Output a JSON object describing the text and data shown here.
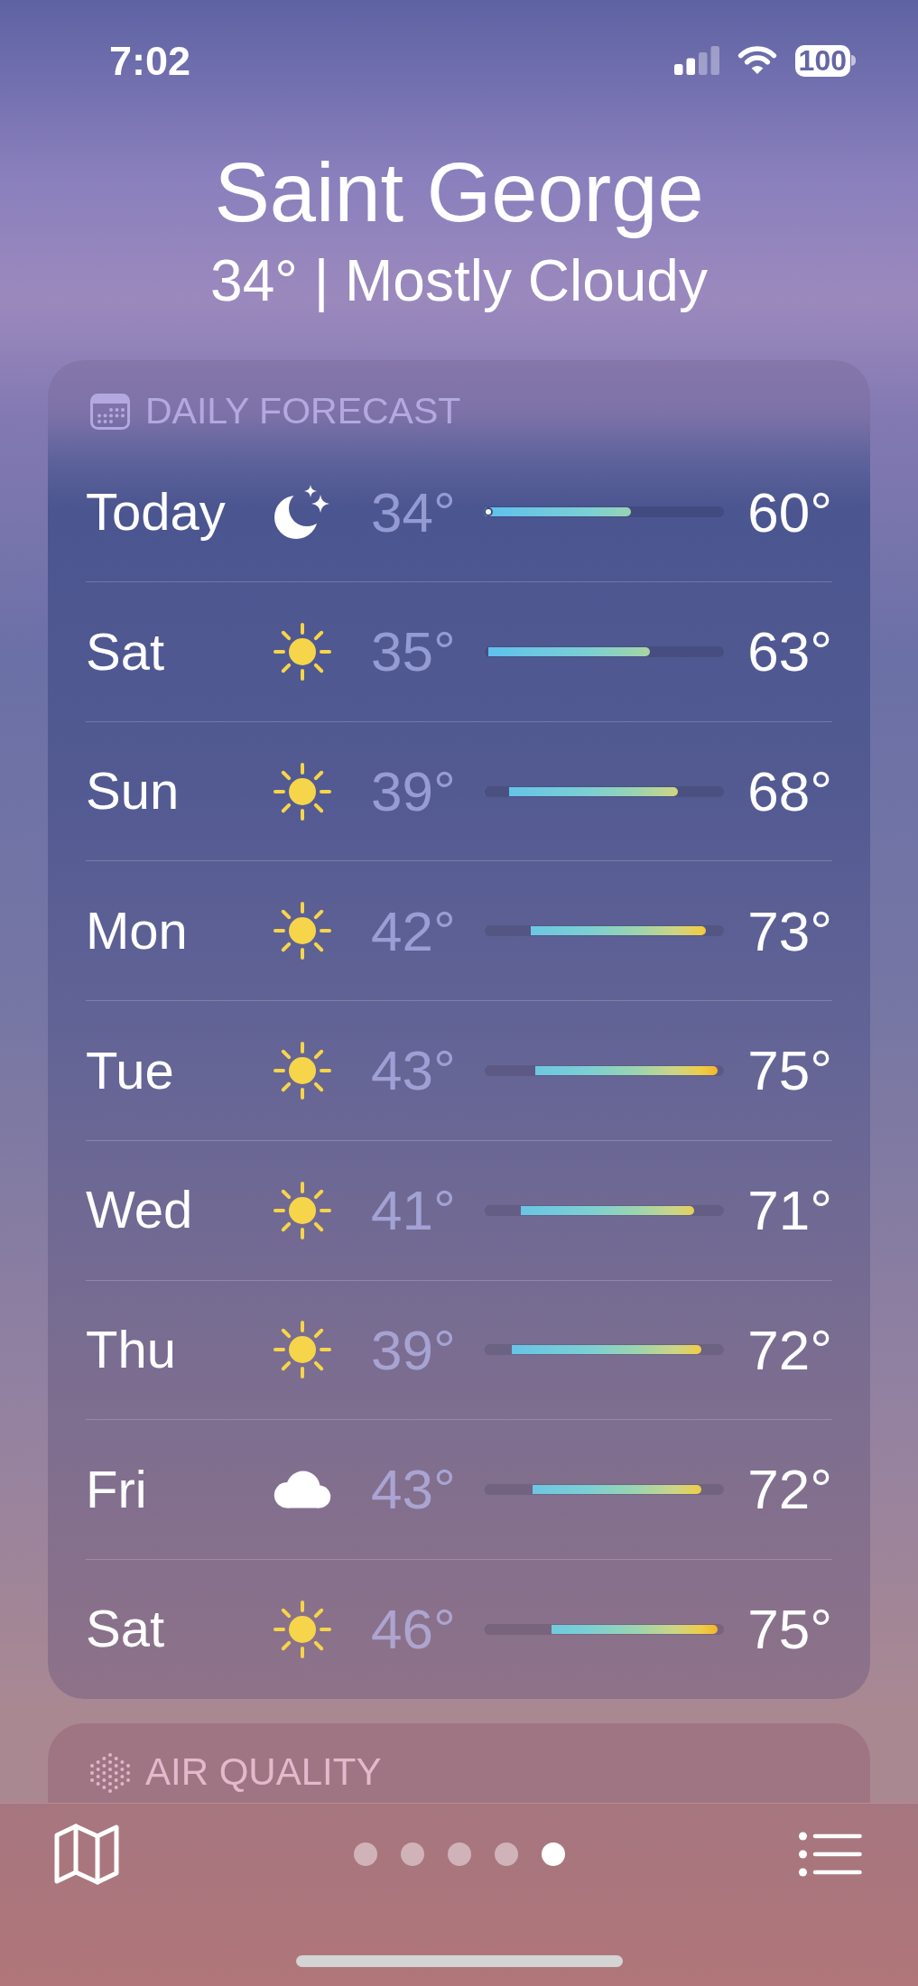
{
  "status_bar": {
    "time": "7:02",
    "battery": "100"
  },
  "location": {
    "city": "Saint George",
    "summary": "34° | Mostly Cloudy"
  },
  "daily_forecast": {
    "title": "DAILY FORECAST",
    "days": [
      {
        "day": "Today",
        "kind": "night",
        "low": "34°",
        "high": "60°",
        "bar": {
          "from": {
            "level": 0
          },
          "to": {
            "level": 0.63
          }
        },
        "current": {
          "level": 0
        }
      },
      {
        "day": "Sat",
        "kind": "sunny",
        "low": "35°",
        "high": "63°",
        "bar": {
          "from": {
            "level": 0.02
          },
          "to": {
            "level": 0.71
          }
        }
      },
      {
        "day": "Sun",
        "kind": "sunny",
        "low": "39°",
        "high": "68°",
        "bar": {
          "from": {
            "level": 0.11
          },
          "to": {
            "level": 0.83
          }
        }
      },
      {
        "day": "Mon",
        "kind": "sunny",
        "low": "42°",
        "high": "73°",
        "bar": {
          "from": {
            "level": 0.2
          },
          "to": {
            "level": 0.95
          }
        }
      },
      {
        "day": "Tue",
        "kind": "sunny",
        "low": "43°",
        "high": "75°",
        "bar": {
          "from": {
            "level": 0.22
          },
          "to": {
            "level": 1
          }
        }
      },
      {
        "day": "Wed",
        "kind": "sunny",
        "low": "41°",
        "high": "71°",
        "bar": {
          "from": {
            "level": 0.16
          },
          "to": {
            "level": 0.9
          }
        }
      },
      {
        "day": "Thu",
        "kind": "sunny",
        "low": "39°",
        "high": "72°",
        "bar": {
          "from": {
            "level": 0.12
          },
          "to": {
            "level": 0.93
          }
        }
      },
      {
        "day": "Fri",
        "kind": "cloudy",
        "low": "43°",
        "high": "72°",
        "bar": {
          "from": {
            "level": 0.21
          },
          "to": {
            "level": 0.93
          }
        }
      },
      {
        "day": "Sat",
        "kind": "sunny",
        "low": "46°",
        "high": "75°",
        "bar": {
          "from": {
            "level": 0.29
          },
          "to": {
            "level": 1
          }
        }
      }
    ]
  },
  "air_quality": {
    "title": "AIR QUALITY"
  },
  "bottom_bar": {
    "pages": [
      {
        "selected": false
      },
      {
        "selected": false
      },
      {
        "selected": false
      },
      {
        "selected": false
      },
      {
        "selected": true
      }
    ]
  }
}
